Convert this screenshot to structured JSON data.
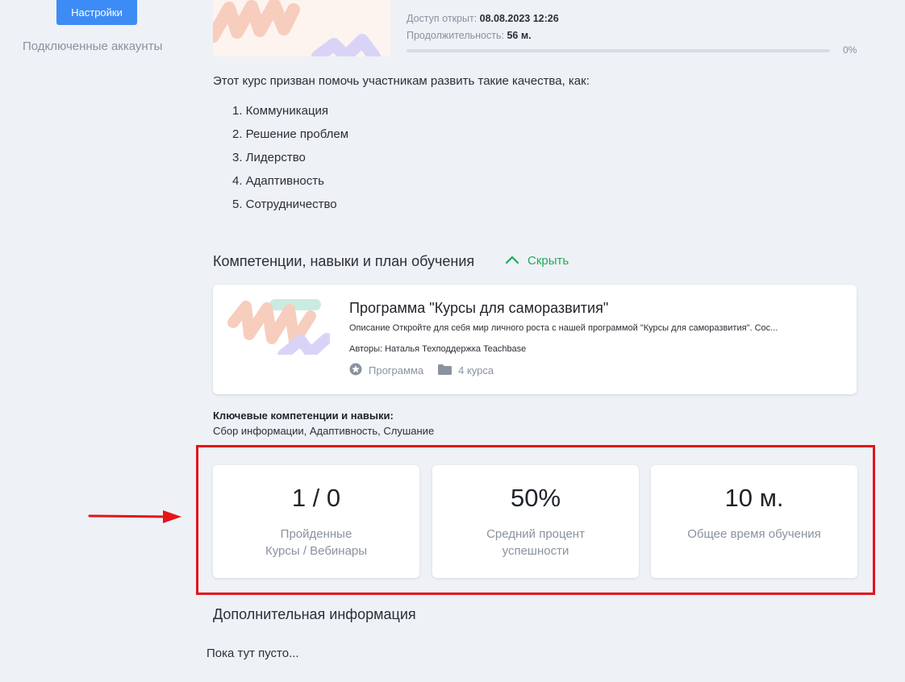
{
  "sidebar": {
    "settings_label": "Настройки",
    "accounts_label": "Подключенные аккаунты"
  },
  "course": {
    "access_label": "Доступ открыт:",
    "access_value": "08.08.2023 12:26",
    "duration_label": "Продолжительность:",
    "duration_value": "56 м.",
    "progress_percent": 0,
    "progress_text": "0%",
    "intro": "Этот курс призван помочь участникам развить такие качества, как:",
    "qualities": [
      "1. Коммуникация",
      "2. Решение проблем",
      "3. Лидерство",
      "4. Адаптивность",
      "5. Сотрудничество"
    ]
  },
  "competencies": {
    "title": "Компетенции, навыки и план обучения",
    "toggle_label": "Скрыть",
    "toggle_icon": "chevron-up-icon",
    "accent_color": "#1eab5a",
    "program": {
      "title": "Программа \"Курсы для саморазвития\"",
      "description": "Описание Откройте для себя мир личного роста с нашей программой \"Курсы для саморазвития\". Сос...",
      "authors": "Авторы: Наталья Техподдержка Teachbase",
      "type_label": "Программа",
      "type_icon": "star-badge-icon",
      "count_label": "4 курса",
      "count_icon": "folder-icon"
    },
    "skills_label": "Ключевые компетенции и навыки:",
    "skills_value": "Сбор информации, Адаптивность, Слушание"
  },
  "stats": [
    {
      "value": "1 / 0",
      "label_line1": "Пройденные",
      "label_line2": "Курсы / Вебинары"
    },
    {
      "value": "50%",
      "label_line1": "Средний процент",
      "label_line2": "успешности"
    },
    {
      "value": "10 м.",
      "label_line1": "Общее время обучения",
      "label_line2": ""
    }
  ],
  "annotation": {
    "highlight_color": "#e4141b"
  },
  "additional": {
    "title": "Дополнительная информация",
    "empty_text": "Пока тут пусто..."
  },
  "colors": {
    "primary": "#3d8cf5",
    "muted": "#8a929e",
    "background": "#eef1f6"
  }
}
